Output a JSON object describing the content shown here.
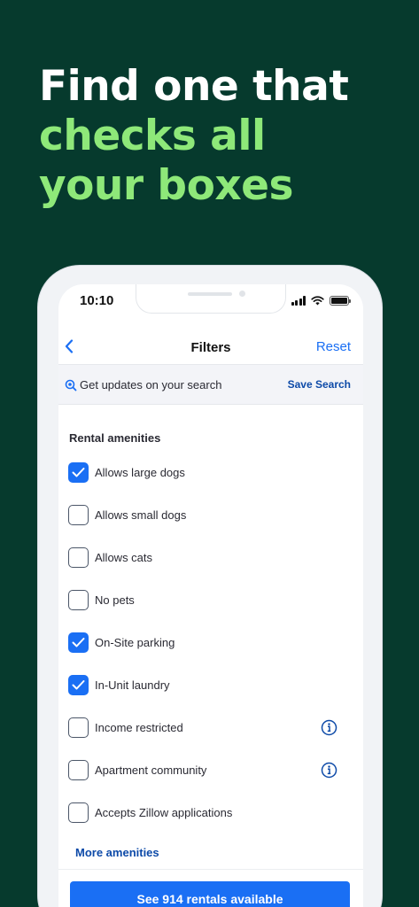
{
  "headline": {
    "line1": "Find one that",
    "line2": "checks all",
    "line3": "your boxes"
  },
  "status_bar": {
    "time": "10:10"
  },
  "nav": {
    "title": "Filters",
    "reset_label": "Reset",
    "back_icon": "chevron-left-icon"
  },
  "save_bar": {
    "text": "Get updates on your search",
    "save_label": "Save Search"
  },
  "section_title": "Rental amenities",
  "amenities": [
    {
      "label": "Allows large dogs",
      "checked": true
    },
    {
      "label": "Allows small dogs",
      "checked": false
    },
    {
      "label": "Allows cats",
      "checked": false
    },
    {
      "label": "No pets",
      "checked": false
    },
    {
      "label": "On-Site parking",
      "checked": true
    },
    {
      "label": "In-Unit laundry",
      "checked": true
    },
    {
      "label": "Income restricted",
      "checked": false,
      "info": true
    },
    {
      "label": "Apartment community",
      "checked": false,
      "info": true
    },
    {
      "label": "Accepts Zillow applications",
      "checked": false
    }
  ],
  "more_amenities": "More amenities",
  "cta": "See 914 rentals available",
  "colors": {
    "background": "#063a2d",
    "headline_green": "#8ee879",
    "accent_blue": "#1a6ff4",
    "link_blue": "#0d4aa8"
  }
}
